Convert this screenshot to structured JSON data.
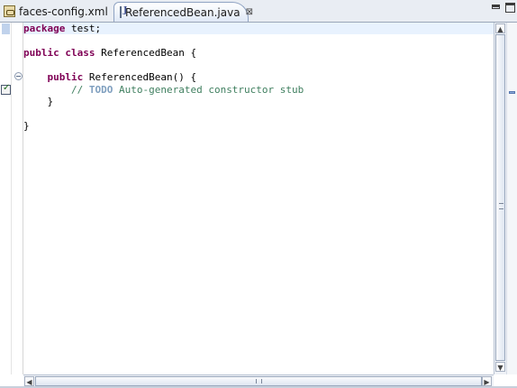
{
  "tabs": [
    {
      "label": "faces-config.xml",
      "icon": "xml-file-icon",
      "active": false
    },
    {
      "label": "ReferencedBean.java",
      "icon": "java-file-icon",
      "active": true,
      "close_glyph": "⊠"
    }
  ],
  "window_controls": {
    "minimize_icon": "minimize-icon",
    "maximize_icon": "maximize-icon"
  },
  "code": {
    "lines": [
      [
        {
          "t": "package",
          "c": "kw"
        },
        {
          "t": " test;",
          "c": ""
        }
      ],
      [],
      [
        {
          "t": "public",
          "c": "kw"
        },
        {
          "t": " ",
          "c": ""
        },
        {
          "t": "class",
          "c": "kw"
        },
        {
          "t": " ReferencedBean {",
          "c": ""
        }
      ],
      [],
      [
        {
          "t": "    ",
          "c": ""
        },
        {
          "t": "public",
          "c": "kw"
        },
        {
          "t": " ReferencedBean() {",
          "c": ""
        }
      ],
      [
        {
          "t": "        ",
          "c": ""
        },
        {
          "t": "// ",
          "c": "cm"
        },
        {
          "t": "TODO",
          "c": "todo"
        },
        {
          "t": " Auto-generated constructor stub",
          "c": "cm"
        }
      ],
      [
        {
          "t": "    }",
          "c": ""
        }
      ],
      [],
      [
        {
          "t": "}",
          "c": ""
        }
      ]
    ]
  },
  "colors": {
    "keyword": "#7f0055",
    "comment": "#3f7f5f",
    "todo": "#7f9fbf",
    "current_line": "#e8f2fe"
  },
  "scrollbars": {
    "up_glyph": "▲",
    "down_glyph": "▼",
    "left_glyph": "◀",
    "right_glyph": "▶"
  }
}
